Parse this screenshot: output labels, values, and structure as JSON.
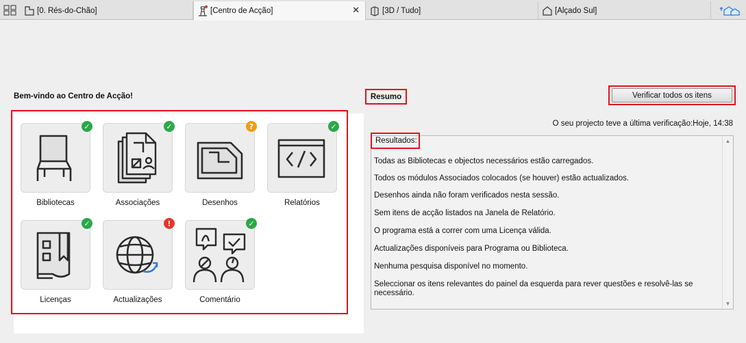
{
  "tabs": [
    {
      "label": "[0. Rés-do-Chão]",
      "icon": "floor-plan-icon"
    },
    {
      "label": "[Centro de Acção]",
      "icon": "lighthouse-icon",
      "active": true
    },
    {
      "label": "[3D / Tudo]",
      "icon": "3d-view-icon"
    },
    {
      "label": "[Alçado Sul]",
      "icon": "elevation-icon"
    }
  ],
  "tab_close": "✕",
  "welcome": "Bem-vindo ao Centro de Acção!",
  "tiles": [
    {
      "label": "Bibliotecas",
      "status": "ok",
      "badge": "✓"
    },
    {
      "label": "Associações",
      "status": "ok",
      "badge": "✓"
    },
    {
      "label": "Desenhos",
      "status": "question",
      "badge": "?"
    },
    {
      "label": "Relatórios",
      "status": "ok",
      "badge": "✓"
    },
    {
      "label": "Licenças",
      "status": "ok",
      "badge": "✓"
    },
    {
      "label": "Actualizações",
      "status": "error",
      "badge": "!"
    },
    {
      "label": "Comentário",
      "status": "ok",
      "badge": "✓"
    }
  ],
  "summary": {
    "title": "Resumo",
    "verify_button": "Verificar todos os itens",
    "last_check": "O seu projecto teve a última verificação:Hoje, 14:38",
    "results_title": "Resultados:",
    "results": [
      "Todas as Bibliotecas e objectos necessários estão carregados.",
      "Todos os módulos Associados colocados (se houver) estão actualizados.",
      "Desenhos ainda não foram verificados nesta sessão.",
      "Sem itens de acção listados na Janela de Relatório.",
      "O programa está a correr com uma Licença válida.",
      "Actualizações disponíveis para Programa ou Biblioteca.",
      "Nenhuma pesquisa disponível no momento.",
      "Seleccionar os itens relevantes do painel da esquerda para rever questões e resolvê-las se necessário."
    ]
  },
  "colors": {
    "highlight": "#e0141e",
    "ok": "#2aa84a",
    "question": "#f29b16",
    "error": "#e8352b",
    "accent_blue": "#2f7ed8"
  }
}
